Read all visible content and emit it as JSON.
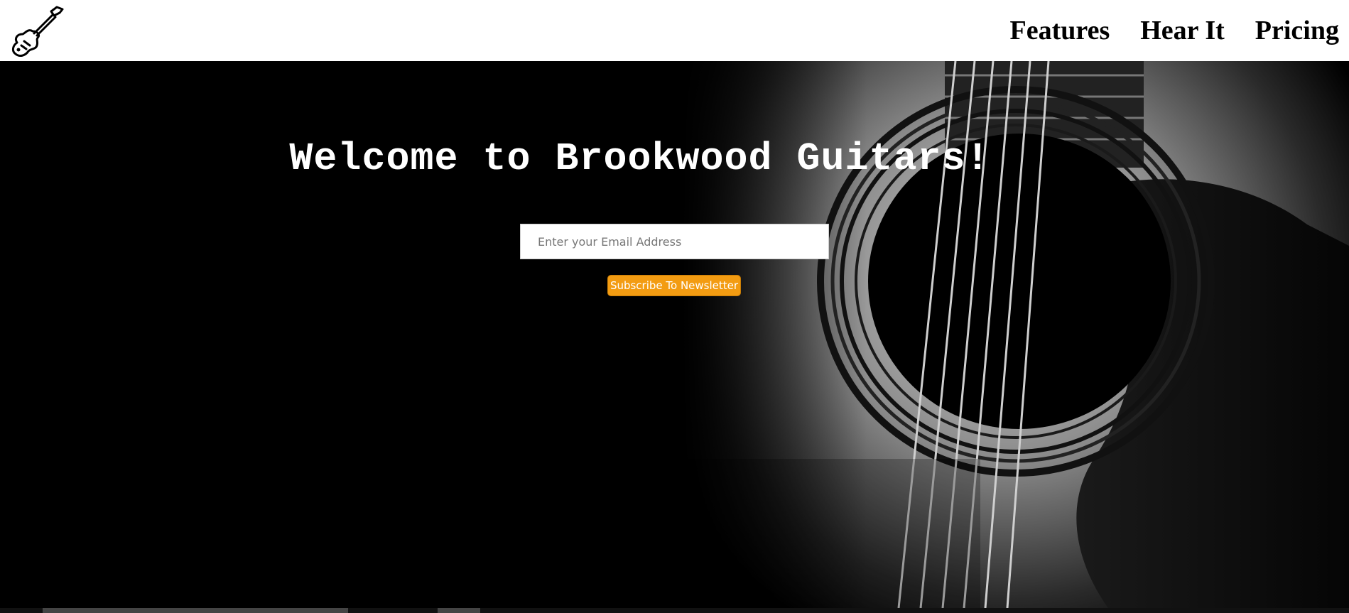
{
  "header": {
    "logo_icon": "electric-guitar-icon",
    "nav": [
      {
        "label": "Features"
      },
      {
        "label": "Hear It"
      },
      {
        "label": "Pricing"
      }
    ]
  },
  "hero": {
    "title": "Welcome to Brookwood Guitars!",
    "email_placeholder": "Enter your Email Address",
    "email_value": "",
    "subscribe_label": "Subscribe To Newsletter",
    "background_image": "acoustic-guitar-soundhole-photo",
    "accent_color": "#f39c12"
  }
}
